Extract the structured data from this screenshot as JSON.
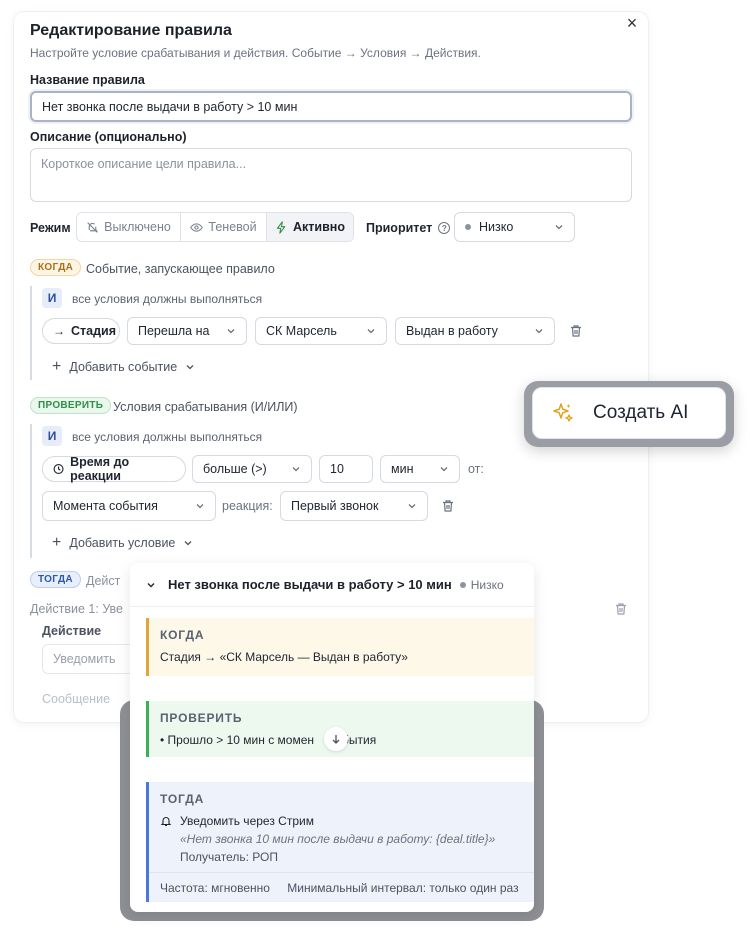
{
  "modal": {
    "title": "Редактирование правила",
    "subtitle": "Настройте условие срабатывания и действия. Событие → Условия → Действия."
  },
  "rule_name": {
    "label": "Название правила",
    "value": "Нет звонка после выдачи в работу > 10 мин"
  },
  "description": {
    "label": "Описание (опционально)",
    "placeholder": "Короткое описание цели правила..."
  },
  "mode": {
    "label": "Режим",
    "options": [
      "Выключено",
      "Теневой",
      "Активно"
    ],
    "selected": "Активно"
  },
  "priority": {
    "label": "Приоритет",
    "value": "Низко"
  },
  "when": {
    "badge": "КОГДА",
    "text": "Событие, запускающее правило",
    "and_chip": "И",
    "and_text": "все условия должны выполняться",
    "field": "Стадия",
    "operator": "Перешла на",
    "pipeline": "СК Марсель",
    "stage": "Выдан в работу",
    "add_label": "Добавить событие"
  },
  "check": {
    "badge": "ПРОВЕРИТЬ",
    "text": "Условия срабатывания (И/ИЛИ)",
    "and_chip": "И",
    "and_text": "все условия должны выполняться",
    "field": "Время до реакции",
    "operator": "больше (>)",
    "amount": "10",
    "unit": "мин",
    "from_label": "от:",
    "from_value": "Момента события",
    "reaction_label": "реакция:",
    "reaction_value": "Первый звонок",
    "add_label": "Добавить условие"
  },
  "then": {
    "badge": "ТОГДА",
    "text": "Дейст",
    "action_title": "Действие 1: Уве",
    "action_label": "Действие",
    "action_value": "Уведомить",
    "message_label": "Сообщение"
  },
  "ai_button": {
    "label": "Создать AI"
  },
  "preview": {
    "title": "Нет звонка после выдачи в работу > 10 мин",
    "priority": "Низко",
    "when_heading": "КОГДА",
    "when_line": "Стадия → «СК Марсель — Выдан в работу»",
    "check_heading": "ПРОВЕРИТЬ",
    "check_line": "• Прошло > 10 мин с момен",
    "check_line_tail": "бытия",
    "then_heading": "ТОГДА",
    "then_action": "Уведомить через Стрим",
    "then_quote": "«Нет звонка 10 мин после выдачи в работу: {deal.title}»",
    "then_recipient": "Получатель: РОП",
    "frequency": "Частота: мгновенно",
    "interval": "Минимальный интервал: только один раз"
  },
  "colors": {
    "when_accent": "#e2a53a",
    "check_accent": "#3fae5b",
    "then_accent": "#4a78d6",
    "ai_sparkle": "#e0a21a"
  }
}
